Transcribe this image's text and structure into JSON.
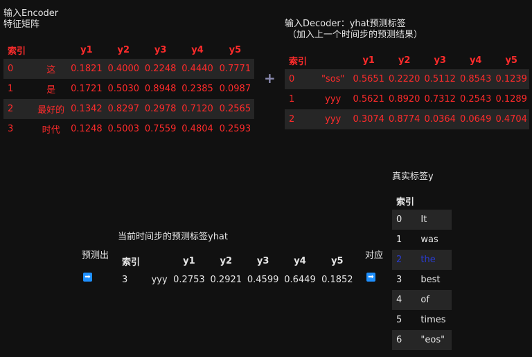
{
  "encoder": {
    "title_line1": "输入Encoder",
    "title_line2": "特征矩阵",
    "headers": [
      "索引",
      "",
      "y1",
      "y2",
      "y3",
      "y4",
      "y5"
    ],
    "rows": [
      [
        "0",
        "这",
        "0.1821",
        "0.4000",
        "0.2248",
        "0.4440",
        "0.7771"
      ],
      [
        "1",
        "是",
        "0.1721",
        "0.5030",
        "0.8948",
        "0.2385",
        "0.0987"
      ],
      [
        "2",
        "最好的",
        "0.1342",
        "0.8297",
        "0.2978",
        "0.7120",
        "0.2565"
      ],
      [
        "3",
        "时代",
        "0.1248",
        "0.5003",
        "0.7559",
        "0.4804",
        "0.2593"
      ]
    ]
  },
  "plus_symbol": "+",
  "decoder": {
    "title_line1": "输入Decoder：yhat预测标签",
    "title_line2": "（加入上一个时间步的预测结果）",
    "headers": [
      "索引",
      "",
      "y1",
      "y2",
      "y3",
      "y4",
      "y5"
    ],
    "rows": [
      [
        "0",
        "\"sos\"",
        "0.5651",
        "0.2220",
        "0.5112",
        "0.8543",
        "0.1239"
      ],
      [
        "1",
        "yyy",
        "0.5621",
        "0.8920",
        "0.7312",
        "0.2543",
        "0.1289"
      ],
      [
        "2",
        "yyy",
        "0.3074",
        "0.8774",
        "0.0364",
        "0.0649",
        "0.4704"
      ]
    ]
  },
  "prediction": {
    "label_left": "预测出",
    "title": "当前时间步的预测标签yhat",
    "headers": [
      "索引",
      "",
      "y1",
      "y2",
      "y3",
      "y4",
      "y5"
    ],
    "row": [
      "3",
      "yyy",
      "0.2753",
      "0.2921",
      "0.4599",
      "0.6449",
      "0.1852"
    ],
    "label_right": "对应"
  },
  "truth": {
    "title": "真实标签y",
    "header": "索引",
    "rows": [
      [
        "0",
        "It"
      ],
      [
        "1",
        "was"
      ],
      [
        "2",
        "the"
      ],
      [
        "3",
        "best"
      ],
      [
        "4",
        "of"
      ],
      [
        "5",
        "times"
      ],
      [
        "6",
        "\"eos\""
      ]
    ],
    "highlight_row": 2
  },
  "colors": {
    "background": "#111111",
    "red_text": "#ff2b2b",
    "highlight_blue": "#2a3ccf",
    "row_stripe": "#262626",
    "arrow_icon": "#1e90ff"
  }
}
